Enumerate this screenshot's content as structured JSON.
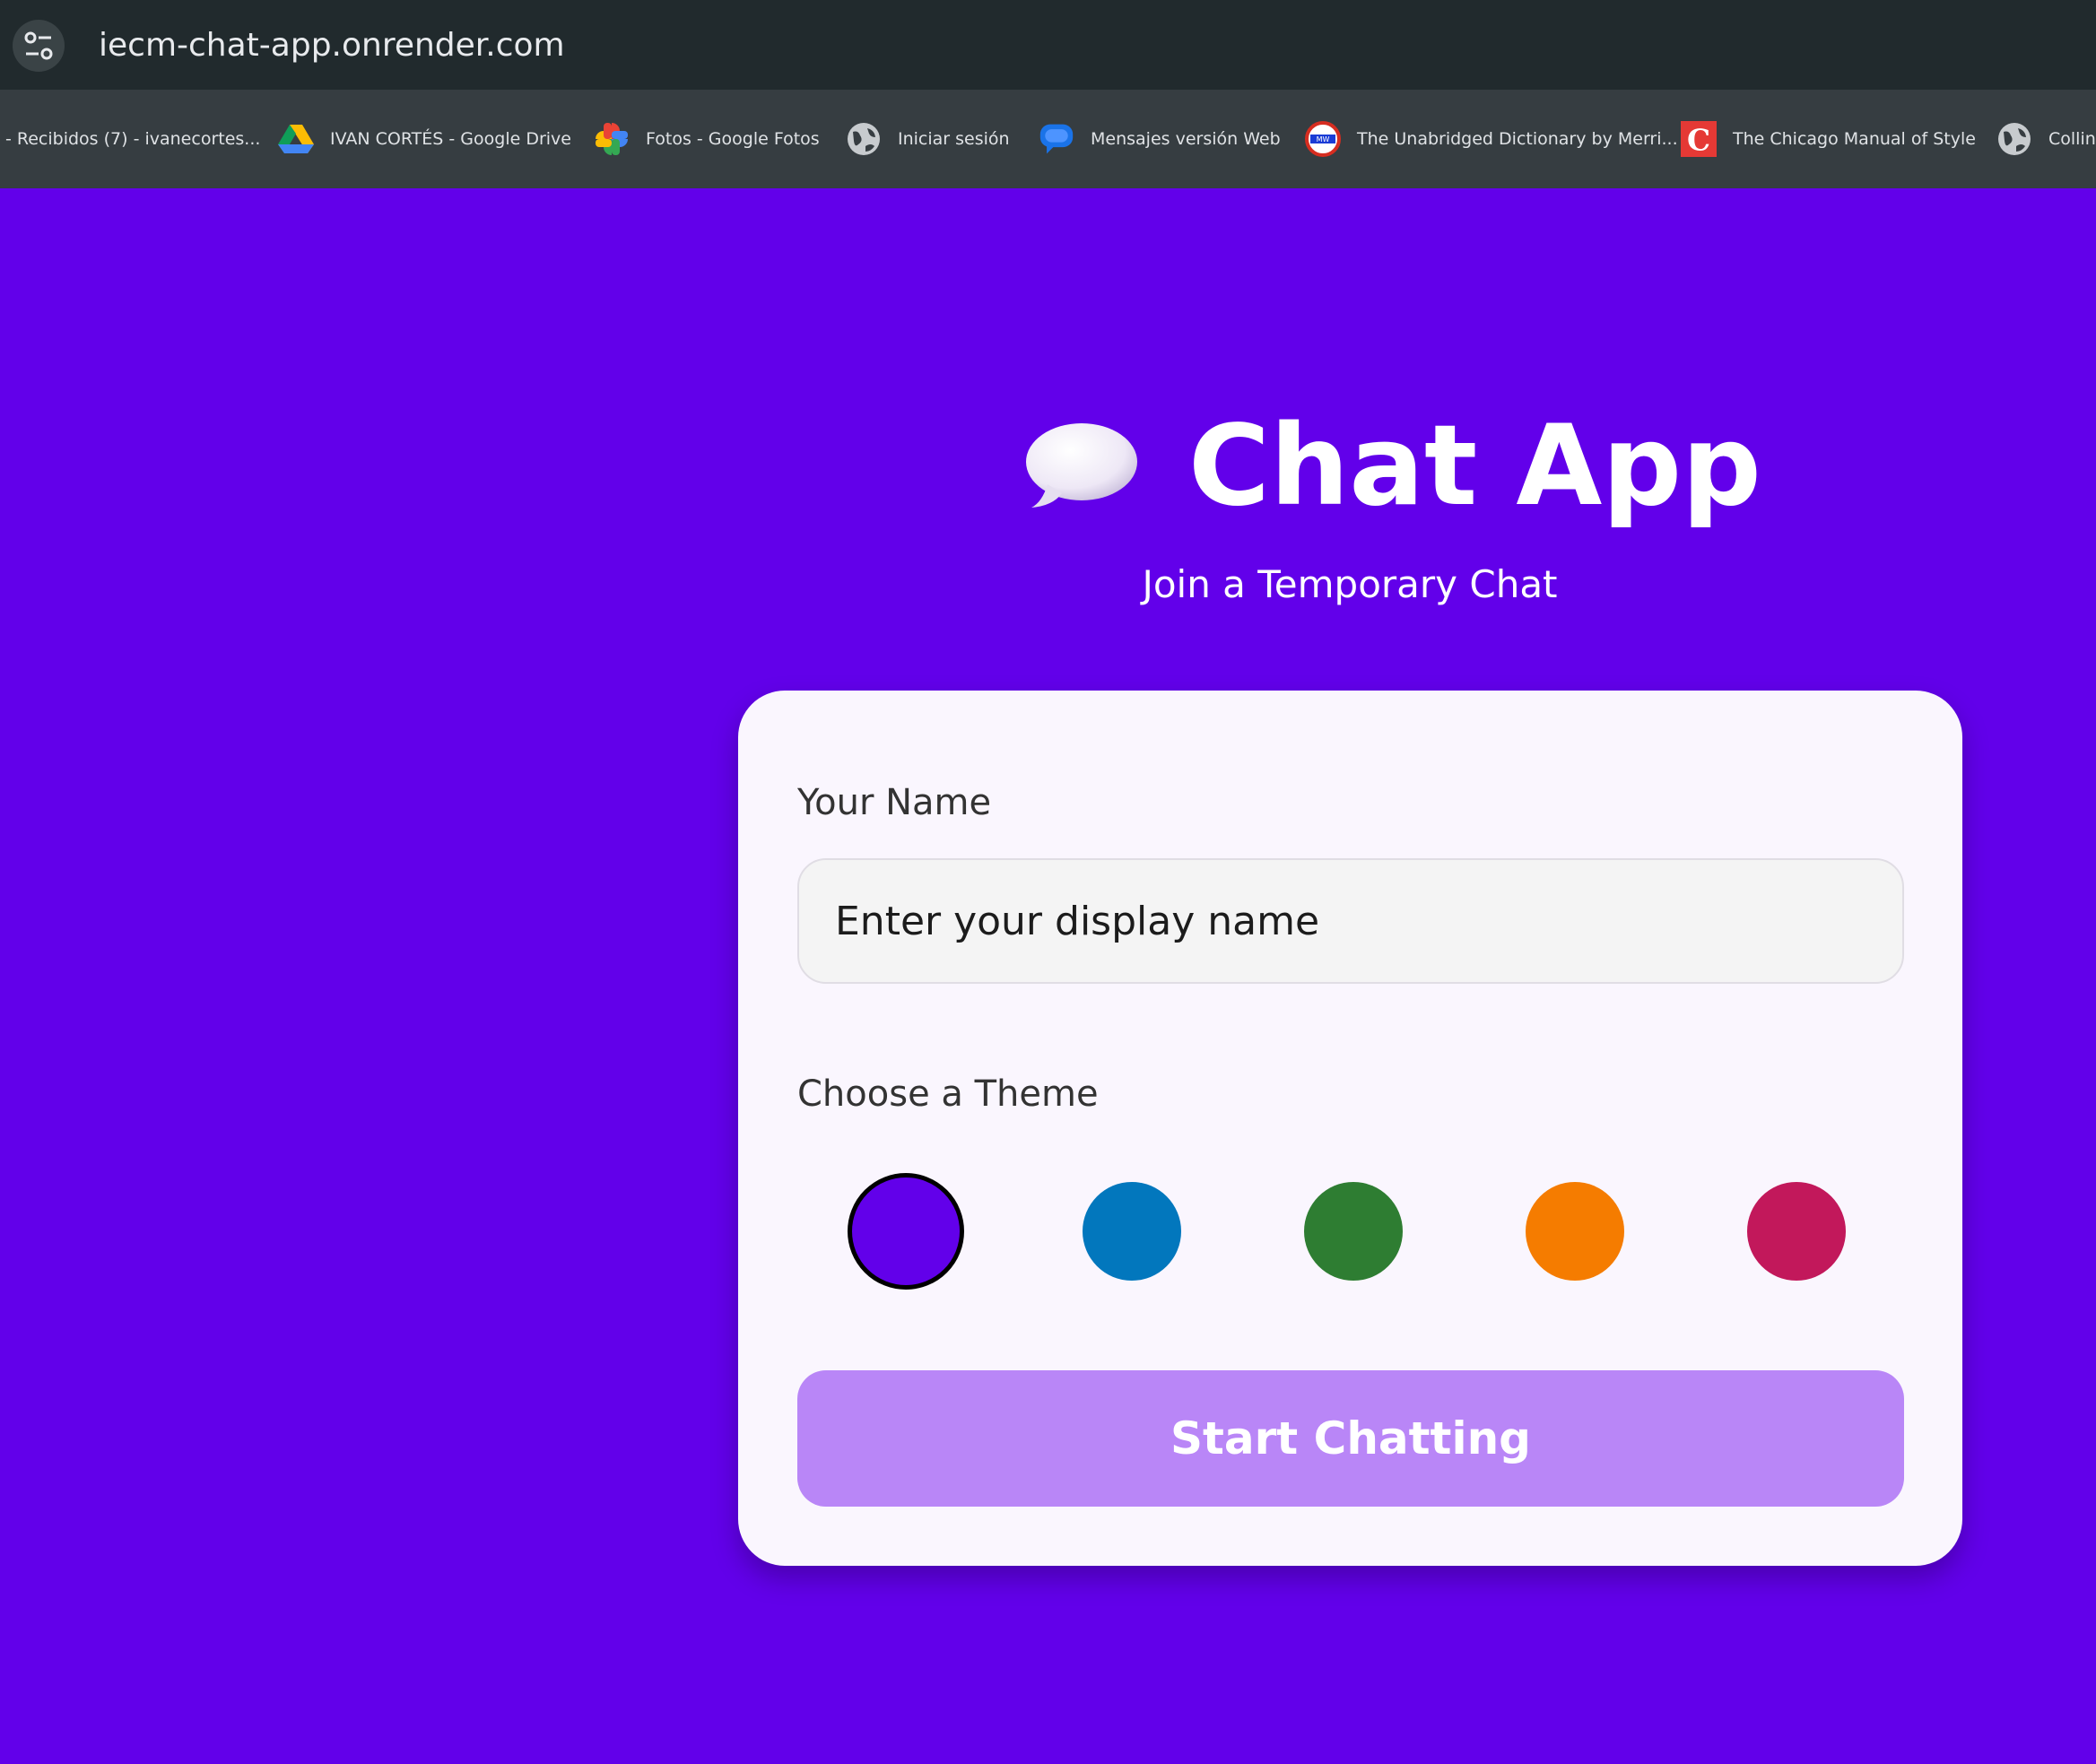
{
  "browser": {
    "url": "iecm-chat-app.onrender.com",
    "bookmarks": [
      {
        "label": "- Recibidos (7) - ivanecortes...",
        "icon": "gmail-icon"
      },
      {
        "label": "IVAN CORTÉS - Google Drive",
        "icon": "google-drive-icon"
      },
      {
        "label": "Fotos - Google Fotos",
        "icon": "google-photos-icon"
      },
      {
        "label": "Iniciar sesión",
        "icon": "globe-icon"
      },
      {
        "label": "Mensajes versión Web",
        "icon": "messages-icon"
      },
      {
        "label": "The Unabridged Dictionary by Merri...",
        "icon": "merriam-webster-icon"
      },
      {
        "label": "The Chicago Manual of Style",
        "icon": "chicago-manual-icon"
      },
      {
        "label": "Collins",
        "icon": "globe-icon"
      }
    ]
  },
  "page": {
    "background": "#6200ea",
    "title": "Chat App",
    "subtitle": "Join a Temporary Chat",
    "name_label": "Your Name",
    "name_placeholder": "Enter your display name",
    "name_value": "",
    "theme_label": "Choose a Theme",
    "themes": [
      {
        "color": "#6200ea",
        "selected": true
      },
      {
        "color": "#0277bd",
        "selected": false
      },
      {
        "color": "#2e7d32",
        "selected": false
      },
      {
        "color": "#f57c00",
        "selected": false
      },
      {
        "color": "#c2185b",
        "selected": false
      }
    ],
    "start_button": "Start Chatting",
    "start_button_color": "#b986f7"
  }
}
